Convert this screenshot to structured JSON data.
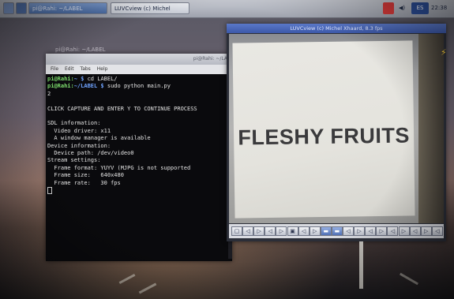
{
  "taskbar": {
    "menu_icon": "raspberry-menu-icon",
    "terminal_button": "pi@Rahi: ~/LABEL",
    "luvcview_button": "LUVCview (c) Michel",
    "keyboard_layout": "ES",
    "clock": "22:38"
  },
  "desktop": {
    "background_label": "pi@Rahi: ~/LABEL"
  },
  "terminal": {
    "title": "pi@Rahi: ~/LA",
    "menu": [
      "File",
      "Edit",
      "Tabs",
      "Help"
    ],
    "prompt_user": "pi@Rahi:",
    "cmd1_dir": "~ $",
    "cmd1": " cd LABEL/",
    "cmd2_dir": "~/LABEL $",
    "cmd2": " sudo python main.py",
    "lines": [
      "2",
      "CLICK CAPTURE AND ENTER Y TO CONTINUE PROCESS",
      "SDL information:",
      "  Video driver: x11",
      "  A window manager is available",
      "Device information:",
      "  Device path: /dev/video0",
      "Stream settings:",
      "  Frame format: YUYV (MJPG is not supported",
      "  Frame size:   640x480",
      "  Frame rate:   30 fps"
    ]
  },
  "luvcview": {
    "title": "LUVCview (c) Michel Xhaard, 8.3 fps",
    "card_text": "FLESHY FRUITS",
    "controls": [
      "▢",
      "◁",
      "▷",
      "◁",
      "▷",
      "▣",
      "◁",
      "▷",
      "▬",
      "▬",
      "◁",
      "▷",
      "◁",
      "▷",
      "◁",
      "▷",
      "◁",
      "▷",
      "◁"
    ]
  }
}
